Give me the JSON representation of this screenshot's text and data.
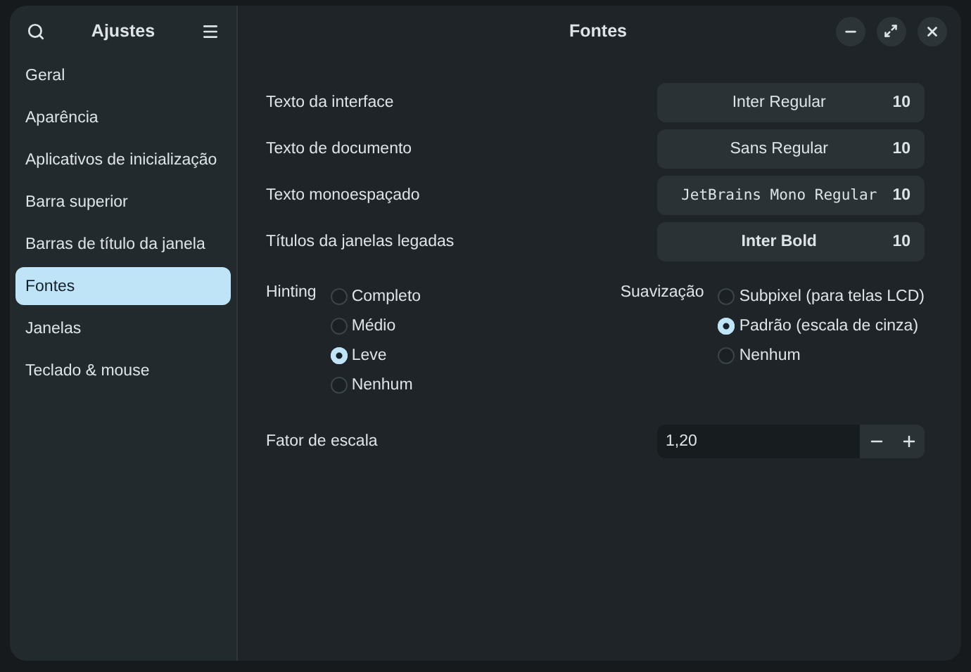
{
  "sidebar": {
    "title": "Ajustes",
    "items": [
      {
        "label": "Geral",
        "selected": false
      },
      {
        "label": "Aparência",
        "selected": false
      },
      {
        "label": "Aplicativos de inicialização",
        "selected": false
      },
      {
        "label": "Barra superior",
        "selected": false
      },
      {
        "label": "Barras de título da janela",
        "selected": false
      },
      {
        "label": "Fontes",
        "selected": true
      },
      {
        "label": "Janelas",
        "selected": false
      },
      {
        "label": "Teclado & mouse",
        "selected": false
      }
    ]
  },
  "window": {
    "title": "Fontes"
  },
  "fonts": [
    {
      "label": "Texto da interface",
      "font": "Inter Regular",
      "size": "10",
      "kind": "regular"
    },
    {
      "label": "Texto de documento",
      "font": "Sans Regular",
      "size": "10",
      "kind": "regular"
    },
    {
      "label": "Texto monoespaçado",
      "font": "JetBrains Mono Regular",
      "size": "10",
      "kind": "mono"
    },
    {
      "label": "Títulos da janelas legadas",
      "font": "Inter Bold",
      "size": "10",
      "kind": "bold"
    }
  ],
  "hinting": {
    "label": "Hinting",
    "options": [
      {
        "label": "Completo",
        "selected": false
      },
      {
        "label": "Médio",
        "selected": false
      },
      {
        "label": "Leve",
        "selected": true
      },
      {
        "label": "Nenhum",
        "selected": false
      }
    ]
  },
  "antialiasing": {
    "label": "Suavização",
    "options": [
      {
        "label": "Subpixel (para telas LCD)",
        "selected": false
      },
      {
        "label": "Padrão (escala de cinza)",
        "selected": true
      },
      {
        "label": "Nenhum",
        "selected": false
      }
    ]
  },
  "scale": {
    "label": "Fator de escala",
    "value": "1,20"
  }
}
